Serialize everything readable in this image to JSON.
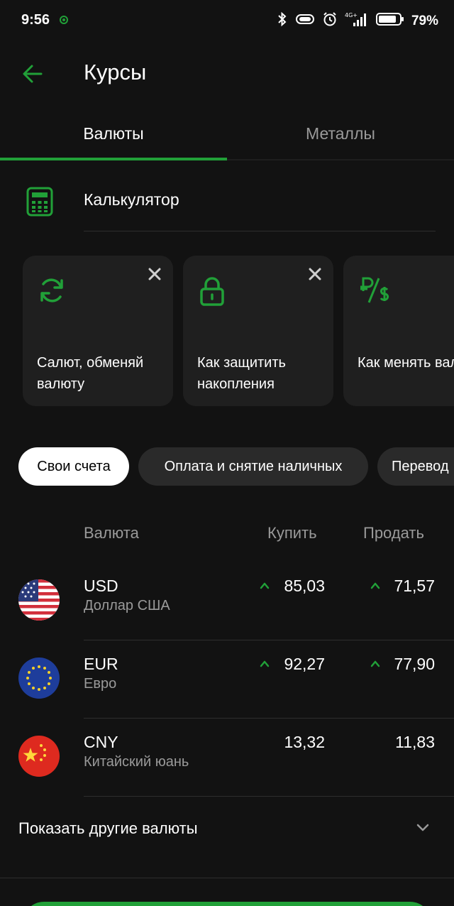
{
  "status_bar": {
    "time": "9:56",
    "battery": "79%",
    "network": "4G+"
  },
  "header": {
    "title": "Курсы"
  },
  "tabs": [
    {
      "label": "Валюты",
      "active": true
    },
    {
      "label": "Металлы",
      "active": false
    }
  ],
  "calculator": {
    "label": "Калькулятор"
  },
  "cards": [
    {
      "icon": "refresh-icon",
      "text": "Салют, обменяй валюту",
      "closable": true
    },
    {
      "icon": "lock-icon",
      "text": "Как защитить накопления",
      "closable": true
    },
    {
      "icon": "ruble-dollar-icon",
      "text": "Как менять валюту",
      "closable": false
    }
  ],
  "chips": [
    {
      "label": "Свои счета",
      "selected": true
    },
    {
      "label": "Оплата и снятие наличных",
      "selected": false
    },
    {
      "label": "Перевод",
      "selected": false
    }
  ],
  "table": {
    "headers": {
      "currency": "Валюта",
      "buy": "Купить",
      "sell": "Продать"
    },
    "rows": [
      {
        "code": "USD",
        "name": "Доллар США",
        "buy": "85,03",
        "sell": "71,57",
        "buy_up": true,
        "sell_up": true
      },
      {
        "code": "EUR",
        "name": "Евро",
        "buy": "92,27",
        "sell": "77,90",
        "buy_up": true,
        "sell_up": true
      },
      {
        "code": "CNY",
        "name": "Китайский юань",
        "buy": "13,32",
        "sell": "11,83",
        "buy_up": false,
        "sell_up": false
      }
    ]
  },
  "show_more": {
    "label": "Показать другие валюты"
  },
  "colors": {
    "accent": "#21a038",
    "background": "#121212",
    "card": "#1f1f1f",
    "secondary_text": "#9a9a9a"
  }
}
